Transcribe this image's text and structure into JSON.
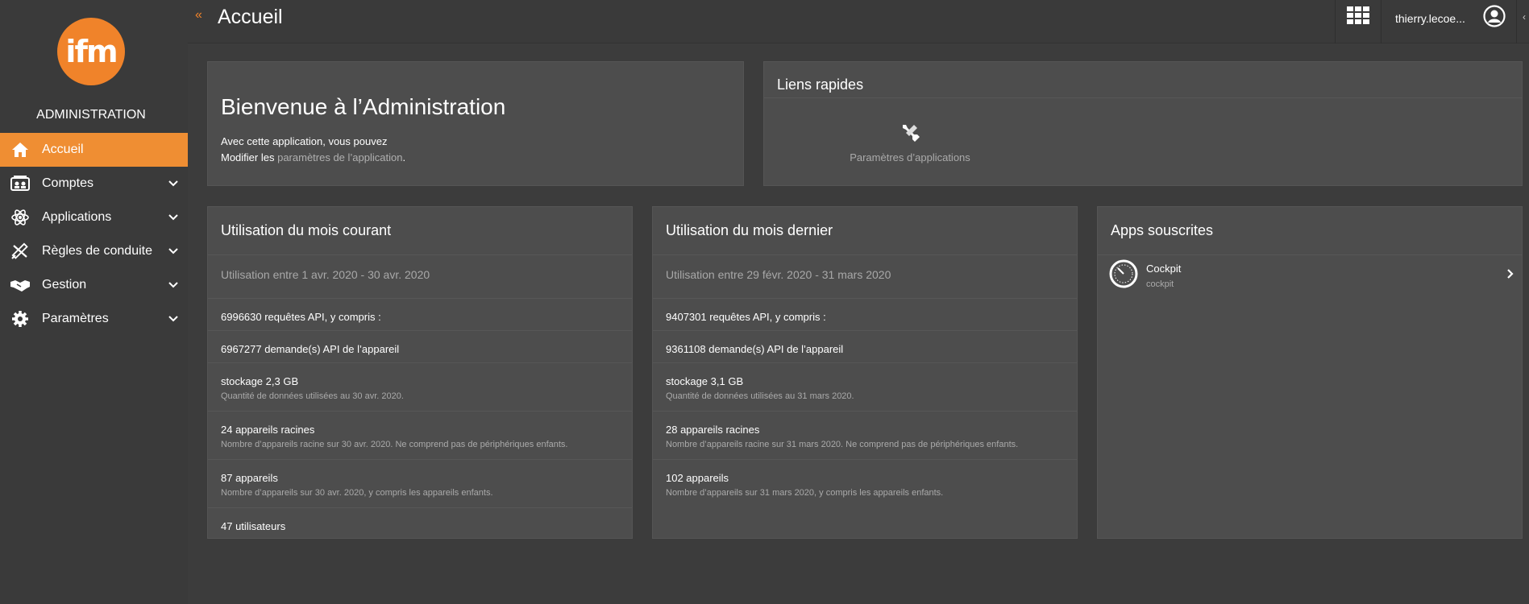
{
  "sidebar": {
    "logo_text": "ifm",
    "app_title": "ADMINISTRATION",
    "items": [
      {
        "label": "Accueil",
        "icon": "home-icon",
        "active": true
      },
      {
        "label": "Comptes",
        "icon": "accounts-icon"
      },
      {
        "label": "Applications",
        "icon": "applications-icon"
      },
      {
        "label": "Règles de conduite",
        "icon": "rules-icon"
      },
      {
        "label": "Gestion",
        "icon": "handshake-icon"
      },
      {
        "label": "Paramètres",
        "icon": "gear-icon"
      }
    ]
  },
  "header": {
    "collapse": "«",
    "title": "Accueil",
    "user": "thierry.lecoe..."
  },
  "welcome": {
    "title": "Bienvenue à l’Administration",
    "line1": "Avec cette application, vous pouvez",
    "line2_prefix": "Modifier les",
    "line2_link": "paramètres de l’application",
    "line2_suffix": "."
  },
  "quick_links": {
    "title": "Liens rapides",
    "item_label": "Paramètres d’applications"
  },
  "current_month": {
    "title": "Utilisation du mois courant",
    "range": "Utilisation entre 1 avr. 2020 - 30 avr. 2020",
    "api": "6996630 requêtes API, y compris :",
    "device_api": "6967277 demande(s) API de l’appareil",
    "storage": "stockage 2,3 GB",
    "storage_sub": "Quantité de données utilisées au 30 avr. 2020.",
    "root_devices": "24 appareils racines",
    "root_devices_sub": "Nombre d’appareils racine sur 30 avr. 2020. Ne comprend pas de périphériques enfants.",
    "devices": "87 appareils",
    "devices_sub": "Nombre d’appareils sur 30 avr. 2020, y compris les appareils enfants.",
    "users": "47 utilisateurs"
  },
  "last_month": {
    "title": "Utilisation du mois dernier",
    "range": "Utilisation entre 29 févr. 2020 - 31 mars 2020",
    "api": "9407301 requêtes API, y compris :",
    "device_api": "9361108 demande(s) API de l’appareil",
    "storage": "stockage 3,1 GB",
    "storage_sub": "Quantité de données utilisées au 31 mars 2020.",
    "root_devices": "28 appareils racines",
    "root_devices_sub": "Nombre d’appareils racine sur 31 mars 2020. Ne comprend pas de périphériques enfants.",
    "devices": "102 appareils",
    "devices_sub": "Nombre d’appareils sur 31 mars 2020, y compris les appareils enfants."
  },
  "subscribed": {
    "title": "Apps souscrites",
    "app_name": "Cockpit",
    "app_id": "cockpit"
  },
  "colors": {
    "accent": "#ef8e33",
    "logo": "#f0832a",
    "card": "#4d4d4d",
    "background": "#3c3c3c"
  }
}
